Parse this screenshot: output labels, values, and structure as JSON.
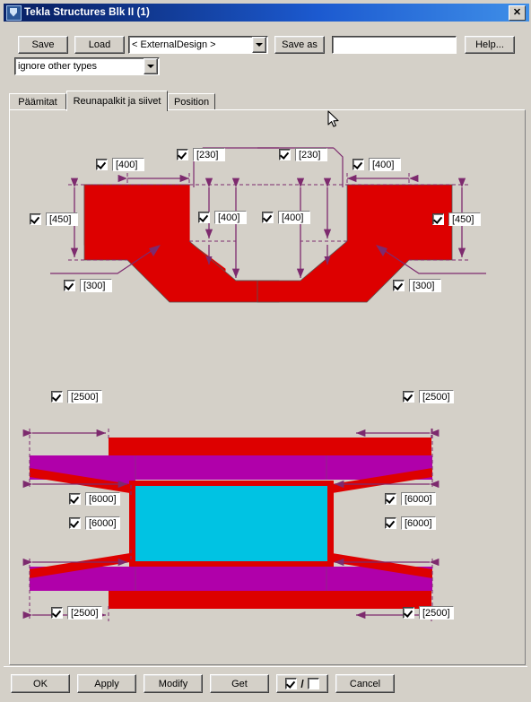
{
  "window": {
    "title": "Tekla Structures  Blk II (1)",
    "icon": "tekla-app-icon",
    "close_label": "✕"
  },
  "toolbar": {
    "save_label": "Save",
    "load_label": "Load",
    "attribute_combo_value": "< ExternalDesign >",
    "save_as_label": "Save as",
    "save_as_value": "",
    "save_as_placeholder": "",
    "help_label": "Help...",
    "filter_combo_value": "ignore other types"
  },
  "tabs": [
    {
      "label": "Päämitat",
      "active": false
    },
    {
      "label": "Reunapalkit ja siivet",
      "active": true
    },
    {
      "label": "Position",
      "active": false
    }
  ],
  "colors": {
    "beam_red": "#dd0000",
    "slab_magenta": "#b000aa",
    "opening_cyan": "#00c3e3",
    "dimension_purple": "#7d2a6e",
    "dialog_gray": "#d4d0c8",
    "title_blue": "#0a246a"
  },
  "section_left": {
    "name": "left-edge-beam-section",
    "fields": [
      {
        "id": "l-top-width",
        "value": "[400]",
        "checked": true
      },
      {
        "id": "l-notch-depth",
        "value": "[230]",
        "checked": true
      },
      {
        "id": "l-height",
        "value": "[450]",
        "checked": true
      },
      {
        "id": "l-lower-depth",
        "value": "[400]",
        "checked": true
      },
      {
        "id": "l-slope",
        "value": "[300]",
        "checked": true
      }
    ]
  },
  "section_right": {
    "name": "right-edge-beam-section",
    "fields": [
      {
        "id": "r-notch-depth",
        "value": "[230]",
        "checked": true
      },
      {
        "id": "r-top-width",
        "value": "[400]",
        "checked": true
      },
      {
        "id": "r-lower-depth",
        "value": "[400]",
        "checked": true
      },
      {
        "id": "r-height",
        "value": "[450]",
        "checked": true
      },
      {
        "id": "r-slope",
        "value": "[300]",
        "checked": true
      }
    ]
  },
  "plan": {
    "name": "plan-view-wing-layout",
    "fields": [
      {
        "id": "p-tl",
        "value": "[2500]",
        "checked": true
      },
      {
        "id": "p-tr",
        "value": "[2500]",
        "checked": true
      },
      {
        "id": "p-lu",
        "value": "[6000]",
        "checked": true
      },
      {
        "id": "p-ll",
        "value": "[6000]",
        "checked": true
      },
      {
        "id": "p-ru",
        "value": "[6000]",
        "checked": true
      },
      {
        "id": "p-rl",
        "value": "[6000]",
        "checked": true
      },
      {
        "id": "p-bl",
        "value": "[2500]",
        "checked": true
      },
      {
        "id": "p-br",
        "value": "[2500]",
        "checked": true
      }
    ]
  },
  "footer": {
    "ok_label": "OK",
    "apply_label": "Apply",
    "modify_label": "Modify",
    "get_label": "Get",
    "toggle_on_label": "✓",
    "toggle_slash": "/",
    "cancel_label": "Cancel"
  }
}
